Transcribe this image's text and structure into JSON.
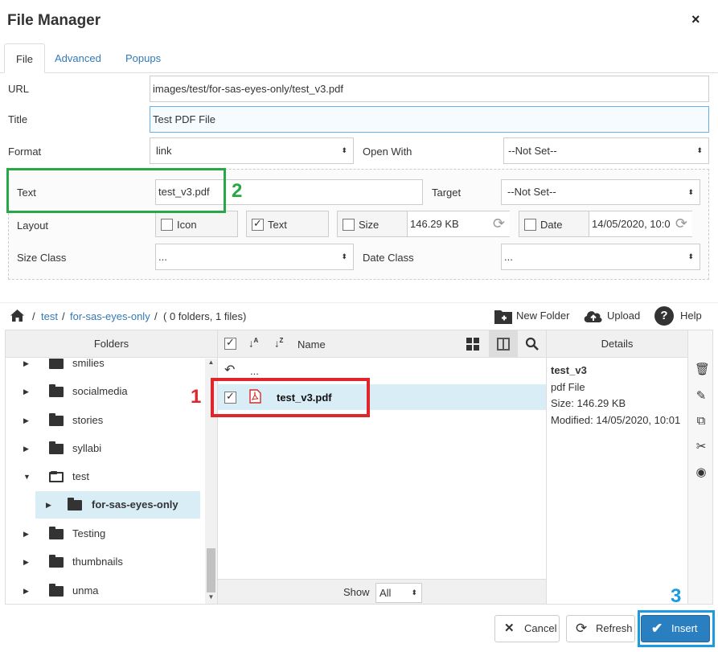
{
  "dialog": {
    "title": "File Manager",
    "close_label": "×"
  },
  "tabs": [
    "File",
    "Advanced",
    "Popups"
  ],
  "form": {
    "url_label": "URL",
    "url_value": "images/test/for-sas-eyes-only/test_v3.pdf",
    "title_label": "Title",
    "title_value": "Test PDF File",
    "format_label": "Format",
    "format_value": "link",
    "open_with_label": "Open With",
    "open_with_value": "--Not Set--",
    "text_label": "Text",
    "text_value": "test_v3.pdf",
    "target_label": "Target",
    "target_value": "--Not Set--",
    "layout_label": "Layout",
    "layout_icon_label": "Icon",
    "layout_icon_checked": false,
    "layout_text_label": "Text",
    "layout_text_checked": true,
    "layout_size_label": "Size",
    "layout_size_checked": false,
    "layout_size_value": "146.29 KB",
    "layout_date_label": "Date",
    "layout_date_checked": false,
    "layout_date_value": "14/05/2020, 10:0",
    "size_class_label": "Size Class",
    "size_class_value": "...",
    "date_class_label": "Date Class",
    "date_class_value": "..."
  },
  "breadcrumb": {
    "items": [
      "test",
      "for-sas-eyes-only"
    ],
    "summary": "( 0 folders, 1 files)",
    "separator": "/"
  },
  "toolbar": {
    "new_folder": "New Folder",
    "upload": "Upload",
    "help": "Help"
  },
  "folders_panel": {
    "header": "Folders",
    "items": [
      {
        "name": "smilies",
        "expanded": false
      },
      {
        "name": "socialmedia",
        "expanded": false
      },
      {
        "name": "stories",
        "expanded": false
      },
      {
        "name": "syllabi",
        "expanded": false
      },
      {
        "name": "test",
        "expanded": true
      },
      {
        "name": "for-sas-eyes-only",
        "expanded": false,
        "selected": true
      },
      {
        "name": "Testing",
        "expanded": false
      },
      {
        "name": "thumbnails",
        "expanded": false
      },
      {
        "name": "unma",
        "expanded": false
      }
    ]
  },
  "files_panel": {
    "name_header": "Name",
    "up_label": "...",
    "files": [
      {
        "name": "test_v3.pdf",
        "checked": true
      }
    ],
    "show_label": "Show",
    "show_value": "All"
  },
  "details_panel": {
    "header": "Details",
    "name": "test_v3",
    "type": "pdf File",
    "size": "Size: 146.29 KB",
    "modified": "Modified: 14/05/2020, 10:01"
  },
  "footer": {
    "cancel": "Cancel",
    "refresh": "Refresh",
    "insert": "Insert"
  },
  "annotations": [
    "1",
    "2",
    "3"
  ],
  "colors": {
    "link": "#337ab7",
    "accent": "#2a7fc1",
    "red_marker": "#e0262d",
    "green_marker": "#28a745",
    "blue_marker": "#1a9be0",
    "selected_row": "#d9edf7"
  }
}
